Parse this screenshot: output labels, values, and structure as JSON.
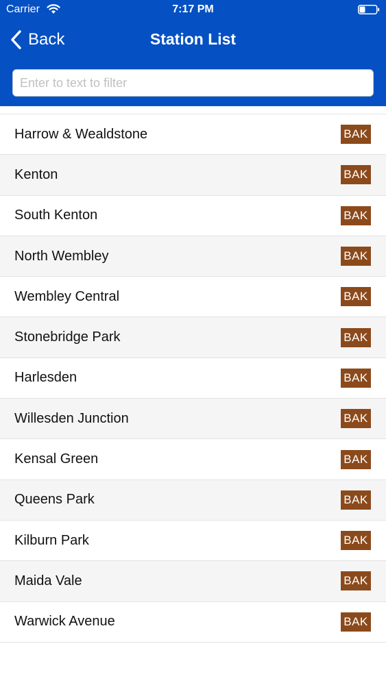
{
  "status_bar": {
    "carrier": "Carrier",
    "time": "7:17 PM",
    "wifi_icon": "wifi-icon",
    "battery_icon": "battery-icon"
  },
  "nav": {
    "back_label": "Back",
    "back_icon": "chevron-left-icon",
    "title": "Station List"
  },
  "filter": {
    "value": "",
    "placeholder": "Enter to text to filter"
  },
  "colors": {
    "header": "#0550c3",
    "badge": "#8b4a1c"
  },
  "stations": [
    {
      "name": "Harrow & Wealdstone",
      "line": "BAK"
    },
    {
      "name": "Kenton",
      "line": "BAK"
    },
    {
      "name": "South Kenton",
      "line": "BAK"
    },
    {
      "name": "North Wembley",
      "line": "BAK"
    },
    {
      "name": "Wembley Central",
      "line": "BAK"
    },
    {
      "name": "Stonebridge Park",
      "line": "BAK"
    },
    {
      "name": "Harlesden",
      "line": "BAK"
    },
    {
      "name": "Willesden Junction",
      "line": "BAK"
    },
    {
      "name": "Kensal Green",
      "line": "BAK"
    },
    {
      "name": "Queens Park",
      "line": "BAK"
    },
    {
      "name": "Kilburn Park",
      "line": "BAK"
    },
    {
      "name": "Maida Vale",
      "line": "BAK"
    },
    {
      "name": "Warwick Avenue",
      "line": "BAK"
    }
  ]
}
